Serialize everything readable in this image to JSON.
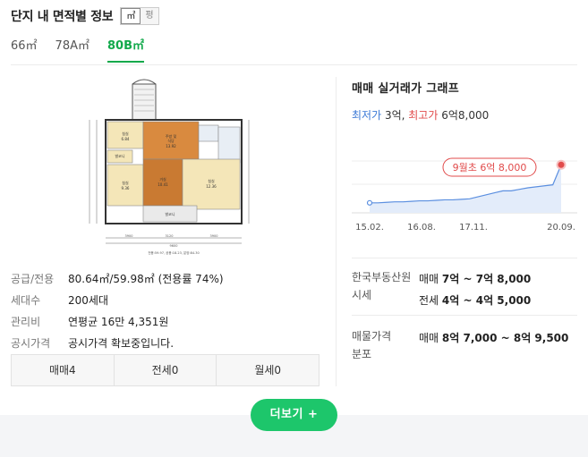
{
  "header": {
    "title": "단지 내 면적별 정보",
    "unit_m2": "㎡",
    "unit_py": "평"
  },
  "tabs": [
    {
      "label": "66㎡"
    },
    {
      "label": "78A㎡"
    },
    {
      "label": "80B㎡"
    }
  ],
  "info": [
    {
      "label": "공급/전용",
      "value": "80.64㎡/59.98㎡ (전용률 74%)"
    },
    {
      "label": "세대수",
      "value": "200세대"
    },
    {
      "label": "관리비",
      "value": "연평균 16만 4,351원"
    },
    {
      "label": "공시가격",
      "value": "공시가격 확보중입니다."
    }
  ],
  "deal_tabs": [
    {
      "label": "매매4"
    },
    {
      "label": "전세0"
    },
    {
      "label": "월세0"
    }
  ],
  "graph": {
    "title": "매매 실거래가 그래프",
    "low_label": "최저가",
    "low_value": " 3억, ",
    "high_label": "최고가",
    "high_value": " 6억8,000"
  },
  "chart_data": {
    "type": "area",
    "x_ticks": [
      "15.02.",
      "16.08.",
      "17.11.",
      "20.09."
    ],
    "callout": "9월초 6억 8,000",
    "series": [
      {
        "values": [
          3.0,
          3.0,
          3.05,
          3.1,
          3.1,
          3.15,
          3.2,
          3.2,
          3.25,
          3.3,
          3.3,
          3.35,
          3.4,
          3.6,
          3.8,
          4.0,
          4.2,
          4.2,
          4.35,
          4.5,
          4.6,
          4.7,
          4.8,
          6.8
        ]
      }
    ],
    "colors": {
      "line": "#5b8fe0",
      "fill": "#e3ecfa",
      "marker": "#e14b4b"
    }
  },
  "stats": {
    "kab_label": "한국부동산원 시세",
    "kab_lines": [
      {
        "kind": "매매",
        "range": "7억 ~ 7억 8,000"
      },
      {
        "kind": "전세",
        "range": "4억 ~ 4억 5,000"
      }
    ],
    "listing_label": "매물가격 분포",
    "listing_lines": [
      {
        "kind": "매매",
        "range": "8억 7,000 ~ 8억 9,500"
      }
    ]
  },
  "more_button": "더보기 +"
}
